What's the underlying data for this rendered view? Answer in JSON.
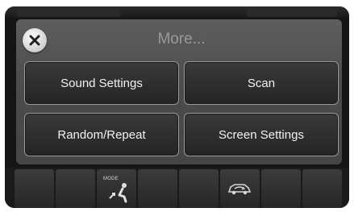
{
  "menu": {
    "title": "More...",
    "close_icon": "close-icon",
    "buttons": [
      {
        "label": "Sound Settings"
      },
      {
        "label": "Scan"
      },
      {
        "label": "Random/Repeat"
      },
      {
        "label": "Screen Settings"
      }
    ]
  },
  "climate_bar": {
    "mode_label": "MODE",
    "mode_icon": "seat-airflow-icon",
    "recirc_icon": "car-recirculation-icon"
  },
  "colors": {
    "panel": "#555555",
    "button_border": "#9a9a9a",
    "title_text": "#9a9a9a",
    "button_text": "#f2f2f2"
  }
}
